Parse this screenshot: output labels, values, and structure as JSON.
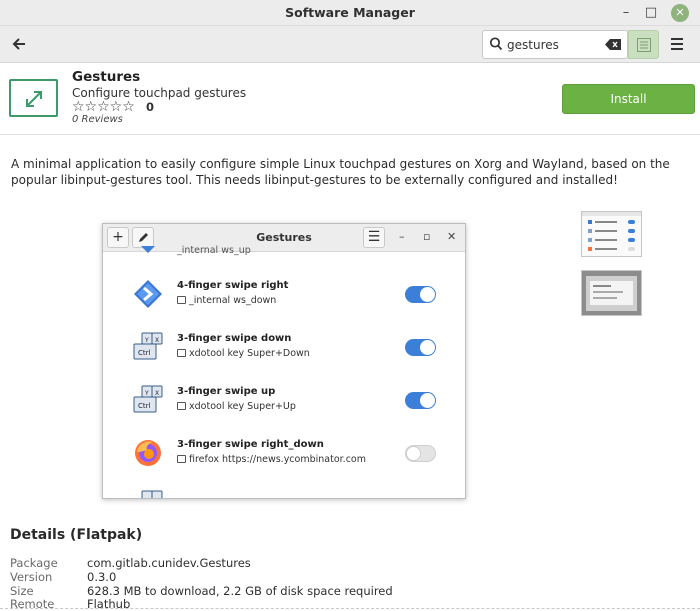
{
  "window": {
    "title": "Software Manager",
    "minimize": "–",
    "maximize": "□",
    "close": "✕"
  },
  "header": {
    "back_icon": "back-arrow-icon",
    "search": {
      "value": "gestures",
      "icon": "search-icon",
      "clear_icon": "backspace-clear-icon"
    },
    "view_icon": "list-view-icon",
    "menu_icon": "hamburger-menu-icon"
  },
  "app": {
    "name": "Gestures",
    "summary": "Configure touchpad gestures",
    "stars": "☆☆☆☆☆",
    "rating_count": "0",
    "reviews": "0 Reviews",
    "install_label": "Install",
    "accent_color": "#6cb144",
    "icon_color": "#3d9b6a"
  },
  "description": "A minimal application to easily configure simple Linux touchpad gestures on Xorg and Wayland, based on the popular libinput-gestures tool. This needs libinput-gestures to be externally configured and installed!",
  "screenshot": {
    "title": "Gestures",
    "add_label": "+",
    "menu_label": "☰",
    "min_label": "–",
    "max_label": "▫",
    "close_label": "✕",
    "partial_top": "_internal ws_up",
    "rows": [
      {
        "title": "4-finger swipe right",
        "command": "_internal ws_down",
        "enabled": true,
        "icon": "workspace-arrow-icon"
      },
      {
        "title": "3-finger swipe down",
        "command": "xdotool key Super+Down",
        "enabled": true,
        "icon": "keyboard-keys-icon"
      },
      {
        "title": "3-finger swipe up",
        "command": "xdotool key Super+Up",
        "enabled": true,
        "icon": "keyboard-keys-icon"
      },
      {
        "title": "3-finger swipe right_down",
        "command": "firefox https://news.ycombinator.com",
        "enabled": false,
        "icon": "firefox-icon"
      }
    ],
    "toggle_color": "#3b7fd9"
  },
  "details": {
    "title": "Details (Flatpak)",
    "rows": [
      {
        "label": "Package",
        "value": "com.gitlab.cunidev.Gestures"
      },
      {
        "label": "Version",
        "value": "0.3.0"
      },
      {
        "label": "Size",
        "value": "628.3 MB to download, 2.2 GB of disk space required"
      },
      {
        "label": "Remote",
        "value": "Flathub"
      }
    ]
  }
}
